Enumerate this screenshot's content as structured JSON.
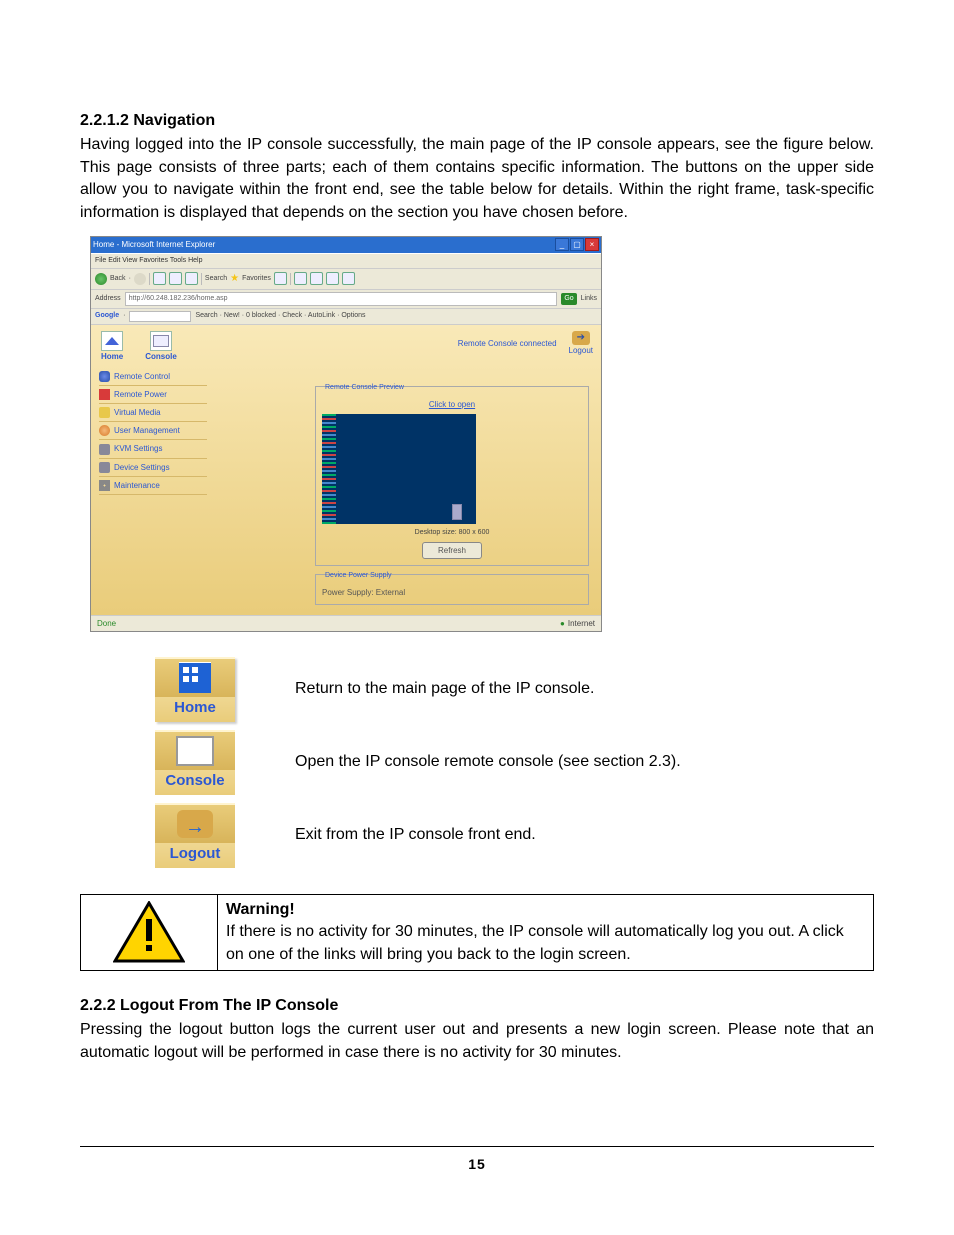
{
  "section1": {
    "number": "2.2.1.2 Navigation",
    "body": "Having logged into the IP console successfully, the main page of the IP console appears, see the figure below. This page consists of three parts; each of them contains specific information. The buttons on the upper side allow you to navigate within the front end, see the table below for details. Within the right frame, task-specific information is displayed that depends on the section you have chosen before."
  },
  "ie_window": {
    "title": "Home - Microsoft Internet Explorer",
    "menubar": "File   Edit   View   Favorites   Tools   Help",
    "toolbar": {
      "back": "Back",
      "search": "Search",
      "favorites": "Favorites"
    },
    "address_label": "Address",
    "address_value": "http://60.248.182.236/home.asp",
    "go": "Go",
    "links": "Links",
    "google_brand": "Google",
    "google_items": "Search  ·  New!  ·  0 blocked  ·  Check  ·  AutoLink  ·  Options",
    "home_label": "Home",
    "console_label": "Console",
    "logout_label": "Logout",
    "status_right": "Remote Console connected",
    "menu_items": [
      "Remote Control",
      "Remote Power",
      "Virtual Media",
      "User Management",
      "KVM Settings",
      "Device Settings",
      "Maintenance"
    ],
    "preview_legend": "Remote Console Preview",
    "preview_link": "Click to open",
    "desktop_size": "Desktop size: 800 x 600",
    "refresh": "Refresh",
    "power_legend": "Device Power Supply",
    "power_text": "Power Supply: External",
    "status_done": "Done",
    "status_internet": "Internet"
  },
  "buttons": {
    "home": {
      "label": "Home",
      "desc": "Return to the main page of the IP console."
    },
    "console": {
      "label": "Console",
      "desc": "Open the IP console remote console (see section 2.3)."
    },
    "logout": {
      "label": "Logout",
      "desc": "Exit from the IP console front end."
    }
  },
  "warning": {
    "title": "Warning!",
    "body": "If there is no activity for 30 minutes, the IP console will automatically log you out. A click on one of the links will bring you back to the login screen."
  },
  "section2": {
    "number": "2.2.2 Logout From The IP Console",
    "body": "Pressing the logout button logs the current user out and presents a new login screen. Please note that an automatic logout will be performed in case there is no activity for 30 minutes."
  },
  "page_number": "15"
}
